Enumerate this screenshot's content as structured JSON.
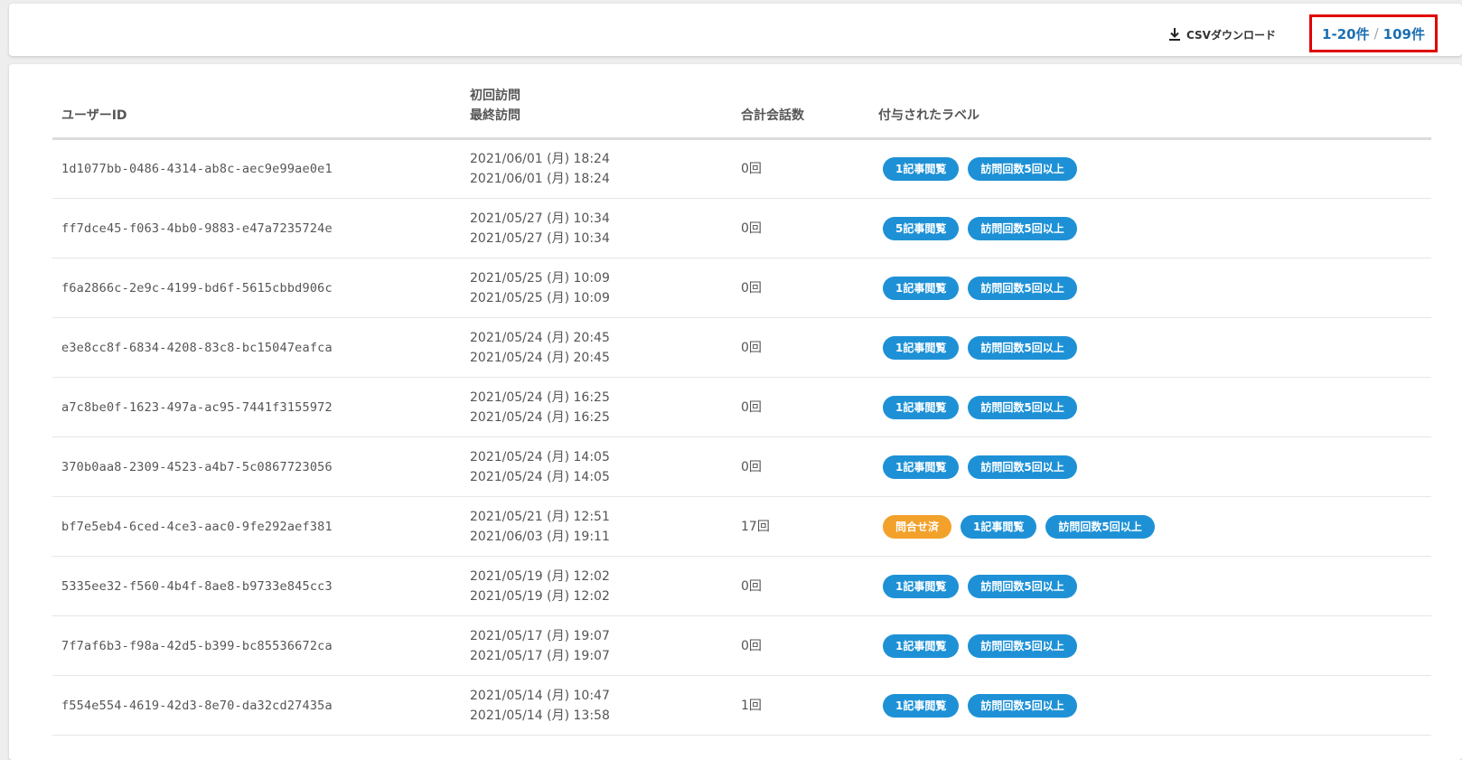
{
  "toolbar": {
    "csv_label": "CSVダウンロード",
    "download_icon": "download-icon",
    "range": "1-20件",
    "separator": "/",
    "total": "109件",
    "highlight_color": "#e10000",
    "link_color": "#1c6fb3"
  },
  "table": {
    "headers": {
      "user_id": "ユーザーID",
      "first_visit": "初回訪問",
      "last_visit": "最終訪問",
      "total_conversations": "合計会話数",
      "labels": "付与されたラベル"
    },
    "label_colors": {
      "blue": "#1e91d6",
      "orange": "#f2a12a"
    },
    "rows": [
      {
        "user_id": "1d1077bb-0486-4314-ab8c-aec9e99ae0e1",
        "first": "2021/06/01 (月) 18:24",
        "last": "2021/06/01 (月) 18:24",
        "count": "0回",
        "labels": [
          {
            "text": "1記事閲覧",
            "color": "blue"
          },
          {
            "text": "訪問回数5回以上",
            "color": "blue"
          }
        ]
      },
      {
        "user_id": "ff7dce45-f063-4bb0-9883-e47a7235724e",
        "first": "2021/05/27 (月) 10:34",
        "last": "2021/05/27 (月) 10:34",
        "count": "0回",
        "labels": [
          {
            "text": "5記事閲覧",
            "color": "blue"
          },
          {
            "text": "訪問回数5回以上",
            "color": "blue"
          }
        ]
      },
      {
        "user_id": "f6a2866c-2e9c-4199-bd6f-5615cbbd906c",
        "first": "2021/05/25 (月) 10:09",
        "last": "2021/05/25 (月) 10:09",
        "count": "0回",
        "labels": [
          {
            "text": "1記事閲覧",
            "color": "blue"
          },
          {
            "text": "訪問回数5回以上",
            "color": "blue"
          }
        ]
      },
      {
        "user_id": "e3e8cc8f-6834-4208-83c8-bc15047eafca",
        "first": "2021/05/24 (月) 20:45",
        "last": "2021/05/24 (月) 20:45",
        "count": "0回",
        "labels": [
          {
            "text": "1記事閲覧",
            "color": "blue"
          },
          {
            "text": "訪問回数5回以上",
            "color": "blue"
          }
        ]
      },
      {
        "user_id": "a7c8be0f-1623-497a-ac95-7441f3155972",
        "first": "2021/05/24 (月) 16:25",
        "last": "2021/05/24 (月) 16:25",
        "count": "0回",
        "labels": [
          {
            "text": "1記事閲覧",
            "color": "blue"
          },
          {
            "text": "訪問回数5回以上",
            "color": "blue"
          }
        ]
      },
      {
        "user_id": "370b0aa8-2309-4523-a4b7-5c0867723056",
        "first": "2021/05/24 (月) 14:05",
        "last": "2021/05/24 (月) 14:05",
        "count": "0回",
        "labels": [
          {
            "text": "1記事閲覧",
            "color": "blue"
          },
          {
            "text": "訪問回数5回以上",
            "color": "blue"
          }
        ]
      },
      {
        "user_id": "bf7e5eb4-6ced-4ce3-aac0-9fe292aef381",
        "first": "2021/05/21 (月) 12:51",
        "last": "2021/06/03 (月) 19:11",
        "count": "17回",
        "labels": [
          {
            "text": "問合せ済",
            "color": "orange"
          },
          {
            "text": "1記事閲覧",
            "color": "blue"
          },
          {
            "text": "訪問回数5回以上",
            "color": "blue"
          }
        ]
      },
      {
        "user_id": "5335ee32-f560-4b4f-8ae8-b9733e845cc3",
        "first": "2021/05/19 (月) 12:02",
        "last": "2021/05/19 (月) 12:02",
        "count": "0回",
        "labels": [
          {
            "text": "1記事閲覧",
            "color": "blue"
          },
          {
            "text": "訪問回数5回以上",
            "color": "blue"
          }
        ]
      },
      {
        "user_id": "7f7af6b3-f98a-42d5-b399-bc85536672ca",
        "first": "2021/05/17 (月) 19:07",
        "last": "2021/05/17 (月) 19:07",
        "count": "0回",
        "labels": [
          {
            "text": "1記事閲覧",
            "color": "blue"
          },
          {
            "text": "訪問回数5回以上",
            "color": "blue"
          }
        ]
      },
      {
        "user_id": "f554e554-4619-42d3-8e70-da32cd27435a",
        "first": "2021/05/14 (月) 10:47",
        "last": "2021/05/14 (月) 13:58",
        "count": "1回",
        "labels": [
          {
            "text": "1記事閲覧",
            "color": "blue"
          },
          {
            "text": "訪問回数5回以上",
            "color": "blue"
          }
        ]
      }
    ]
  }
}
